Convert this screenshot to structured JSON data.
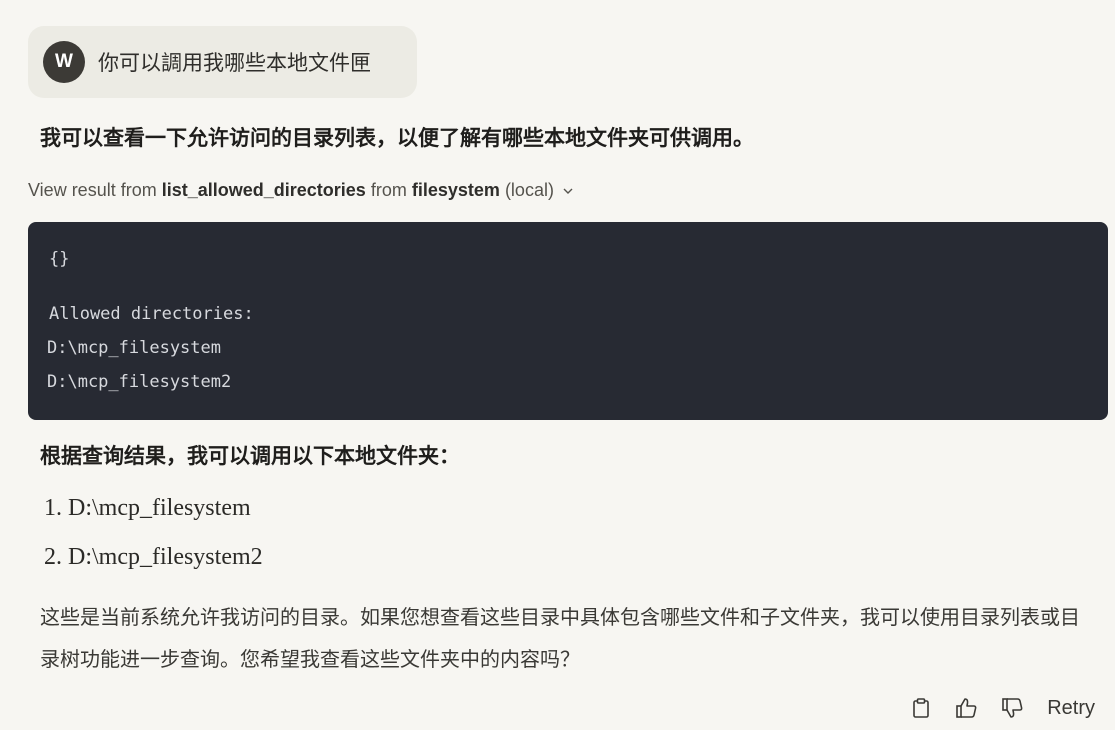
{
  "user_message": {
    "avatar_letter": "W",
    "text": "你可以調用我哪些本地文件匣"
  },
  "assistant": {
    "intro": "我可以查看一下允许访问的目录列表，以便了解有哪些本地文件夹可供调用。",
    "tool_call": {
      "prefix": "View result from ",
      "tool_name": "list_allowed_directories",
      "middle": " from ",
      "server": "filesystem",
      "suffix": " (local)"
    },
    "code": {
      "input": "{}",
      "header": "Allowed directories:",
      "lines": [
        "D:\\mcp_filesystem",
        "D:\\mcp_filesystem2"
      ]
    },
    "result_heading": "根据查询结果，我可以调用以下本地文件夹：",
    "list_items": [
      "1. D:\\mcp_filesystem",
      "2. D:\\mcp_filesystem2"
    ],
    "paragraph": "这些是当前系统允许我访问的目录。如果您想查看这些目录中具体包含哪些文件和子文件夹，我可以使用目录列表或目录树功能进一步查询。您希望我查看这些文件夹中的内容吗？"
  },
  "actions": {
    "retry_label": "Retry",
    "icons": [
      "clipboard-icon",
      "thumbs-up-icon",
      "thumbs-down-icon"
    ]
  }
}
